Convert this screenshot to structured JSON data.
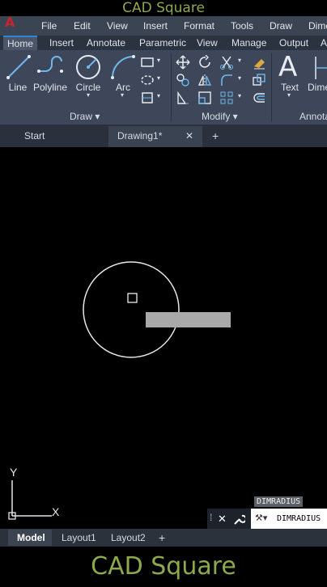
{
  "brand": {
    "top": "CAD Square",
    "bottom": "CAD Square"
  },
  "app": {
    "logo_letter": "A"
  },
  "menu": [
    "File",
    "Edit",
    "View",
    "Insert",
    "Format",
    "Tools",
    "Draw",
    "Dime"
  ],
  "ribbon_tabs": [
    "Home",
    "Insert",
    "Annotate",
    "Parametric",
    "View",
    "Manage",
    "Output",
    "A"
  ],
  "draw_tools": [
    "Line",
    "Polyline",
    "Circle",
    "Arc"
  ],
  "panels": {
    "draw": "Draw ▾",
    "modify": "Modify ▾",
    "annotation": "Annota"
  },
  "annotation_tools": {
    "text": "Text",
    "dim": "Dime"
  },
  "doc_tabs": {
    "start": "Start",
    "drawing": "Drawing1*",
    "close": "✕",
    "add": "+"
  },
  "ucs": {
    "x": "X",
    "y": "Y"
  },
  "command": {
    "tooltip": "DIMRADIUS",
    "input": "DIMRADIUS",
    "close": "✕"
  },
  "layout_tabs": [
    "Model",
    "Layout1",
    "Layout2"
  ],
  "layout_add": "+",
  "colors": {
    "brand": "#8da94a",
    "ribbon": "#3d4759",
    "accent": "#2f86d8",
    "icon_blue": "#6fb7ec"
  }
}
